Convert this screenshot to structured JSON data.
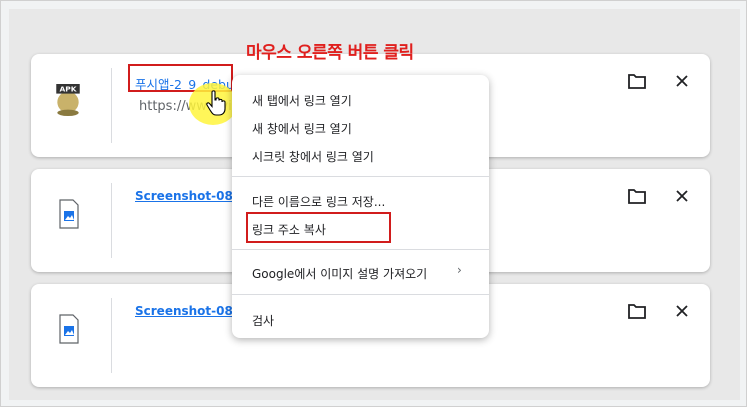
{
  "annotation": "마우스 오른쪽 버튼 클릭",
  "downloads": [
    {
      "filename": "푸시앱-2_9_debu",
      "url": "https://www.vi",
      "file_type_label": "APK"
    },
    {
      "filename": "Screenshot-0806"
    },
    {
      "filename": "Screenshot-0806"
    }
  ],
  "context_menu": {
    "items": [
      "새 탭에서 링크 열기",
      "새 창에서 링크 열기",
      "시크릿 창에서 링크 열기",
      "다른 이름으로 링크 저장...",
      "링크 주소 복사",
      "Google에서 이미지 설명 가져오기",
      "검사"
    ],
    "submenu_arrow": "›"
  },
  "colors": {
    "accent": "#1a73e8",
    "annotation_red": "#e0201e",
    "highlight_box": "#d11c1c",
    "cursor_halo": "#fff53c"
  },
  "icons": {
    "folder": "folder-icon",
    "close": "close-icon",
    "apk": "apk-file-icon",
    "image": "image-file-icon",
    "cursor": "hand-pointer-icon"
  }
}
